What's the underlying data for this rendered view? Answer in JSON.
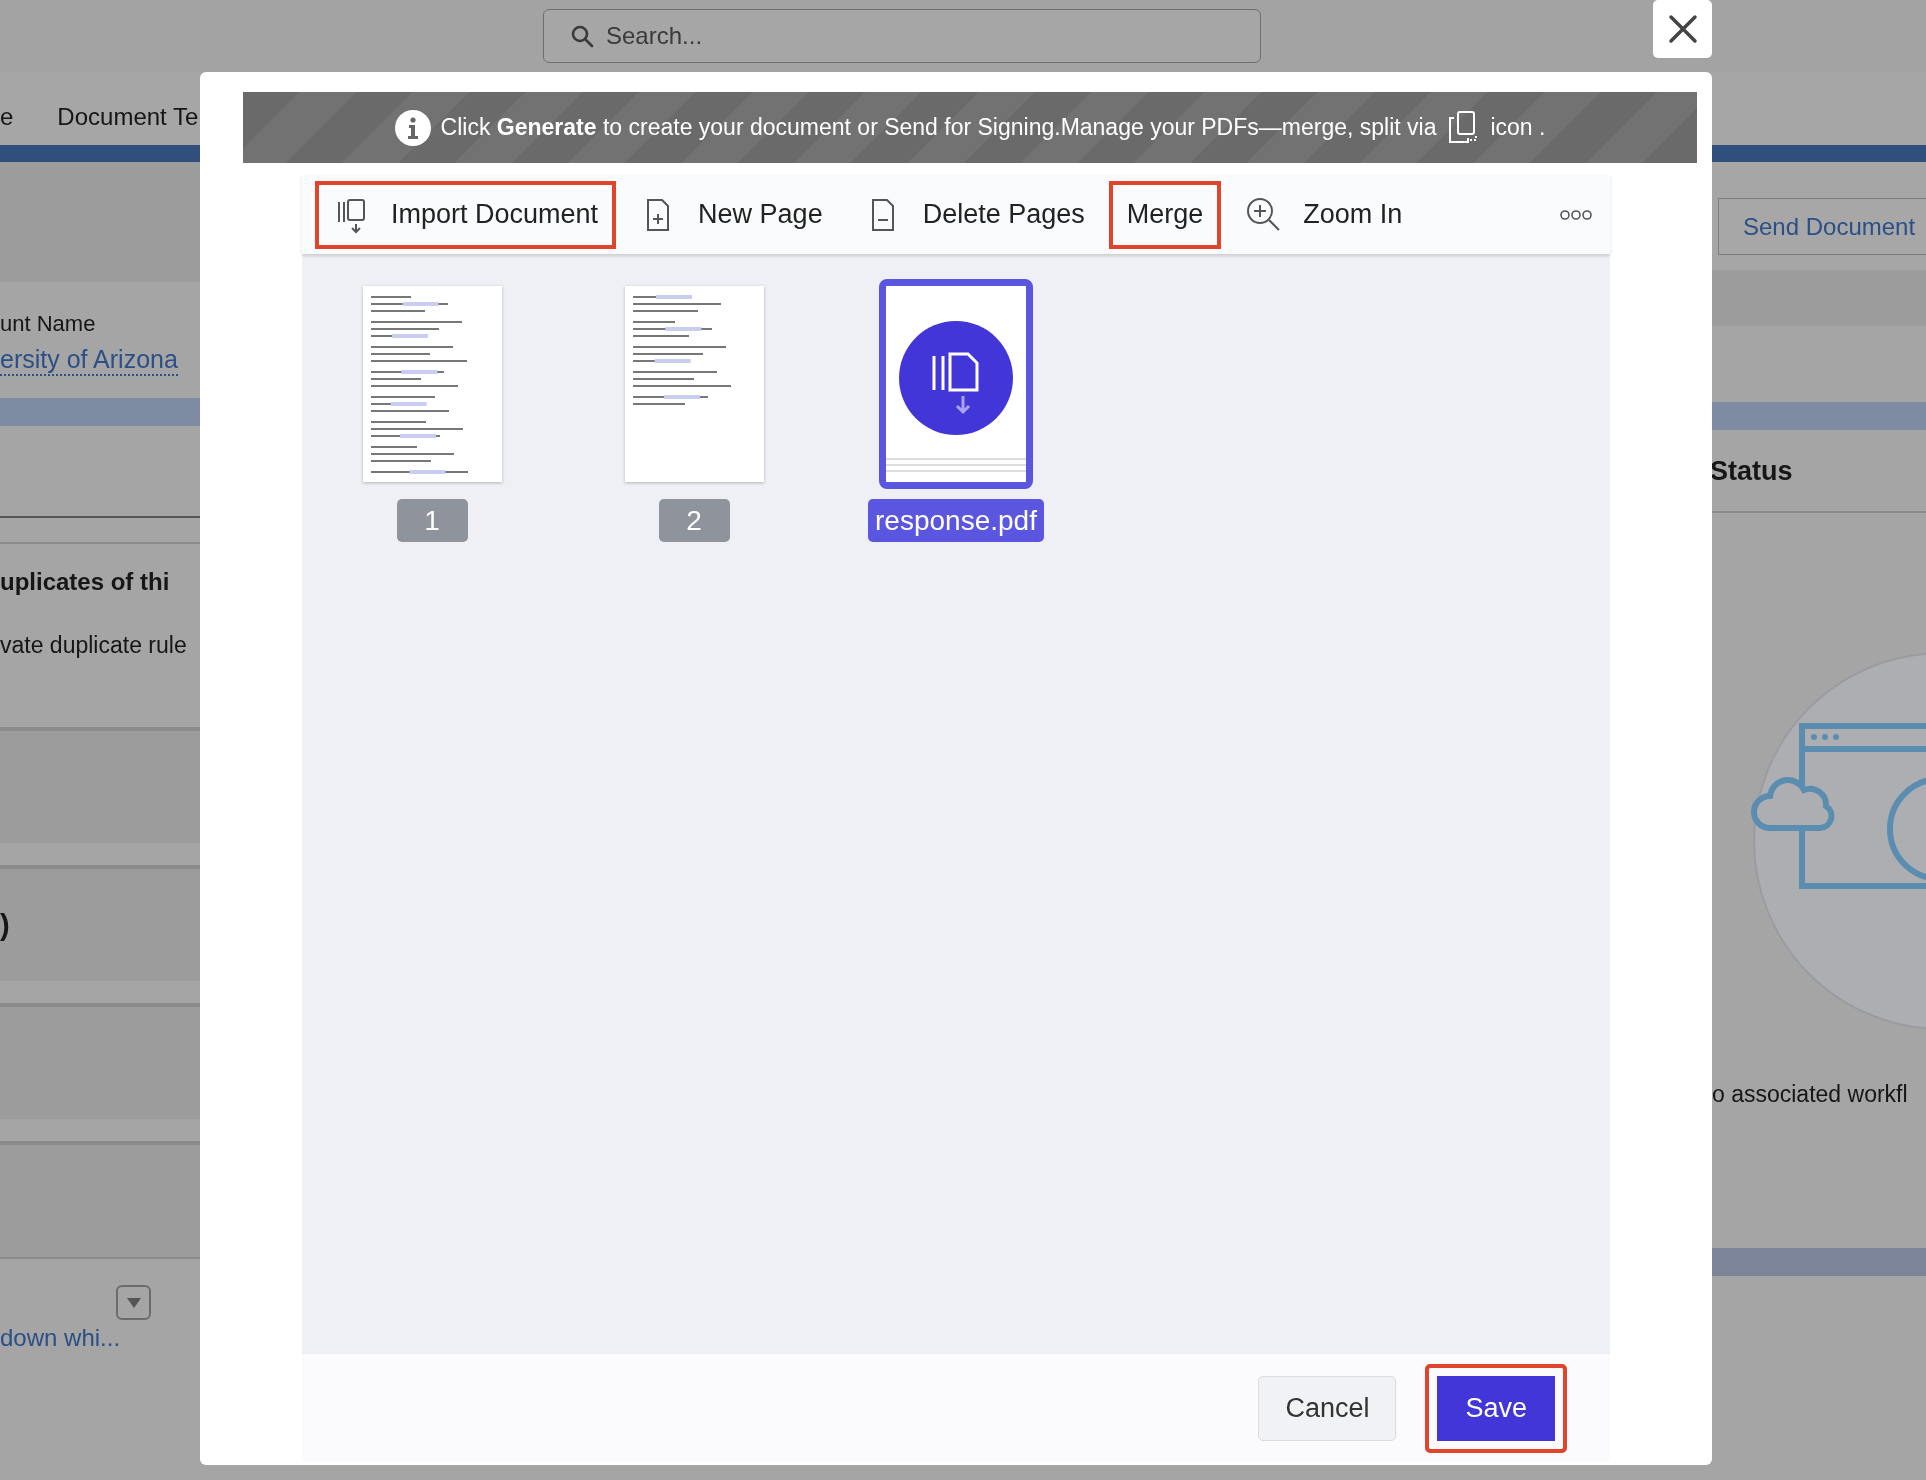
{
  "search": {
    "placeholder": "Search..."
  },
  "background": {
    "nav_tabs": [
      "e",
      "Document Te"
    ],
    "left": {
      "field_label": "unt Name",
      "field_link": "ersity of Arizona",
      "duplicates_title": "uplicates of thi",
      "duplicates_text": "vate duplicate rule",
      "section_title": ")",
      "link": "down whi..."
    },
    "right": {
      "button": "Send Document",
      "card_title": "Status",
      "empty_text": "o associated workfl"
    }
  },
  "modal": {
    "banner": "Click **Generate** to create your document or Send for Signing.Manage your PDFs—merge, split via",
    "banner_suffix": "icon .",
    "toolbar": [
      {
        "label": "Import Document",
        "kind": "import",
        "highlighted": true
      },
      {
        "label": "New Page",
        "kind": "new_page",
        "highlighted": false
      },
      {
        "label": "Delete Pages",
        "kind": "delete_pages",
        "highlighted": false
      },
      {
        "label": "Merge",
        "kind": "text",
        "highlighted": true
      },
      {
        "label": "Zoom In",
        "kind": "zoom_in",
        "highlighted": false
      }
    ],
    "pages": [
      {
        "label": "1",
        "kind": "page",
        "selected": false
      },
      {
        "label": "2",
        "kind": "page",
        "selected": false
      },
      {
        "label": "response.pdf",
        "kind": "file",
        "selected": true
      }
    ],
    "buttons": [
      {
        "label": "Cancel",
        "kind": "secondary",
        "highlighted": false
      },
      {
        "label": "Save",
        "kind": "primary",
        "highlighted": true
      }
    ]
  }
}
